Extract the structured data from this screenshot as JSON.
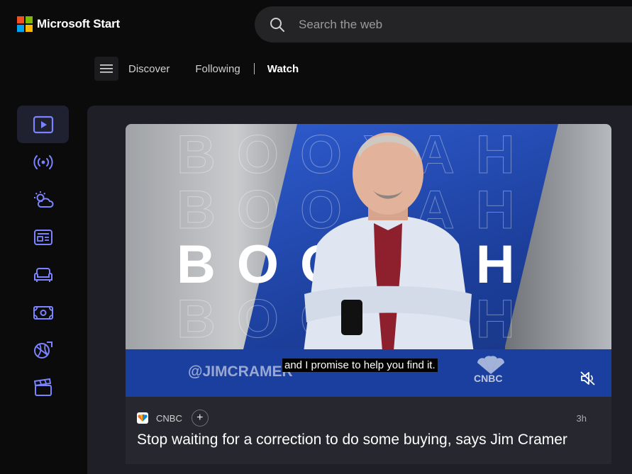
{
  "app": {
    "name": "Microsoft Start"
  },
  "brand_colors": {
    "ms_red": "#f25022",
    "ms_green": "#7fba00",
    "ms_blue": "#00a4ef",
    "ms_yellow": "#ffb900",
    "accent": "#7b83ff"
  },
  "search": {
    "placeholder": "Search the web",
    "value": ""
  },
  "nav": {
    "menu_icon": "hamburger-icon",
    "items": [
      {
        "label": "Discover"
      },
      {
        "label": "Following"
      },
      {
        "label": "Watch"
      }
    ],
    "active": "Watch"
  },
  "sidebar": {
    "items": [
      {
        "icon": "play-video-icon",
        "active": true
      },
      {
        "icon": "live-broadcast-icon"
      },
      {
        "icon": "weather-icon"
      },
      {
        "icon": "news-icon"
      },
      {
        "icon": "sofa-icon"
      },
      {
        "icon": "money-icon"
      },
      {
        "icon": "sports-icon"
      },
      {
        "icon": "movie-clapper-icon"
      }
    ]
  },
  "card": {
    "video": {
      "overlay_word": "BOOYAH",
      "handle": "@JIMCRAMER",
      "caption": "and I promise to help you find it.",
      "network": "CNBC",
      "mute_icon": "volume-muted-icon"
    },
    "source": {
      "name": "CNBC"
    },
    "age": "3h",
    "title": "Stop waiting for a correction to do some buying, says Jim Cramer"
  }
}
